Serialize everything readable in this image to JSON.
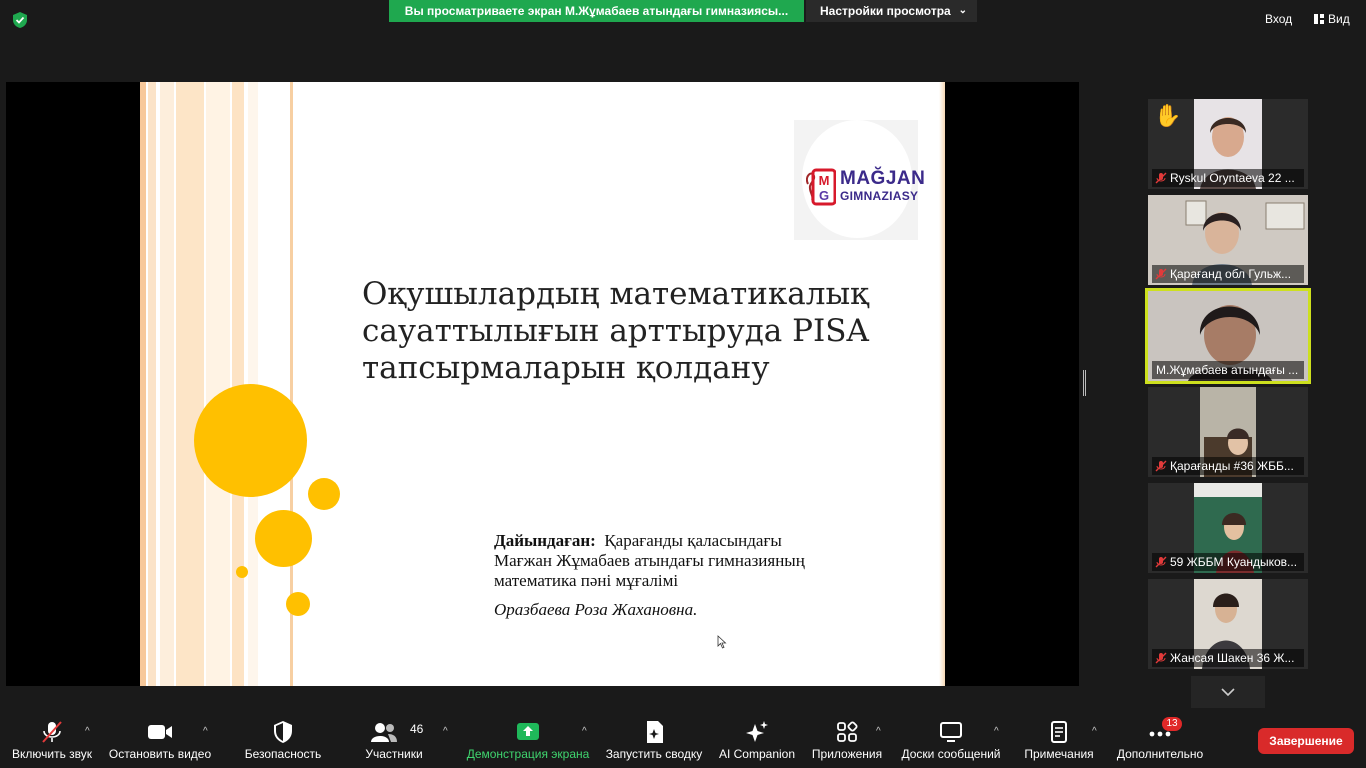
{
  "header": {
    "share_banner": "Вы просматриваете экран М.Жұмабаев атындағы гимназиясы...",
    "view_settings": "Настройки просмотра",
    "enter_label": "Вход",
    "view_label": "Вид"
  },
  "slide": {
    "logo_line1": "MAĞJAN",
    "logo_line2": "GIMNAZIASY",
    "logo_mark": "MG",
    "title_line1": "Оқушылардың математикалық",
    "title_line2": "сауаттылығын арттыруда PISA",
    "title_line3": "тапсырмаларын қолдану",
    "credit_label": "Дайындаған:",
    "credit_text1": "Қарағанды қаласындағы",
    "credit_text2": "Мағжан Жұмабаев атындағы гимназияның",
    "credit_text3": "математика пәні мұғалімі",
    "author": "Оразбаева Роза Жахановна."
  },
  "participants": [
    {
      "name": "Ryskul Oryntaeva 22 ...",
      "muted": true,
      "hand_raised": true
    },
    {
      "name": "Қарағанд обл  Гульж...",
      "muted": true,
      "hand_raised": false
    },
    {
      "name": "М.Жұмабаев атындағы ...",
      "muted": false,
      "active_speaker": true
    },
    {
      "name": "Қарағанды #36 ЖББ...",
      "muted": true
    },
    {
      "name": "59 ЖББМ Куандыков...",
      "muted": true
    },
    {
      "name": "Жансая Шакен 36 Ж...",
      "muted": true
    }
  ],
  "toolbar": {
    "unmute": "Включить звук",
    "stop_video": "Остановить видео",
    "security": "Безопасность",
    "participants": "Участники",
    "participants_count": "46",
    "share_screen": "Демонстрация экрана",
    "summary": "Запустить сводку",
    "ai": "AI Companion",
    "apps": "Приложения",
    "whiteboards": "Доски сообщений",
    "notes": "Примечания",
    "more": "Дополнительно",
    "more_badge": "13",
    "end": "Завершение"
  },
  "colors": {
    "share_green": "#1fa84f",
    "end_red": "#d92a2a",
    "active_border": "#cde01e",
    "slide_circles": "#ffc000"
  }
}
